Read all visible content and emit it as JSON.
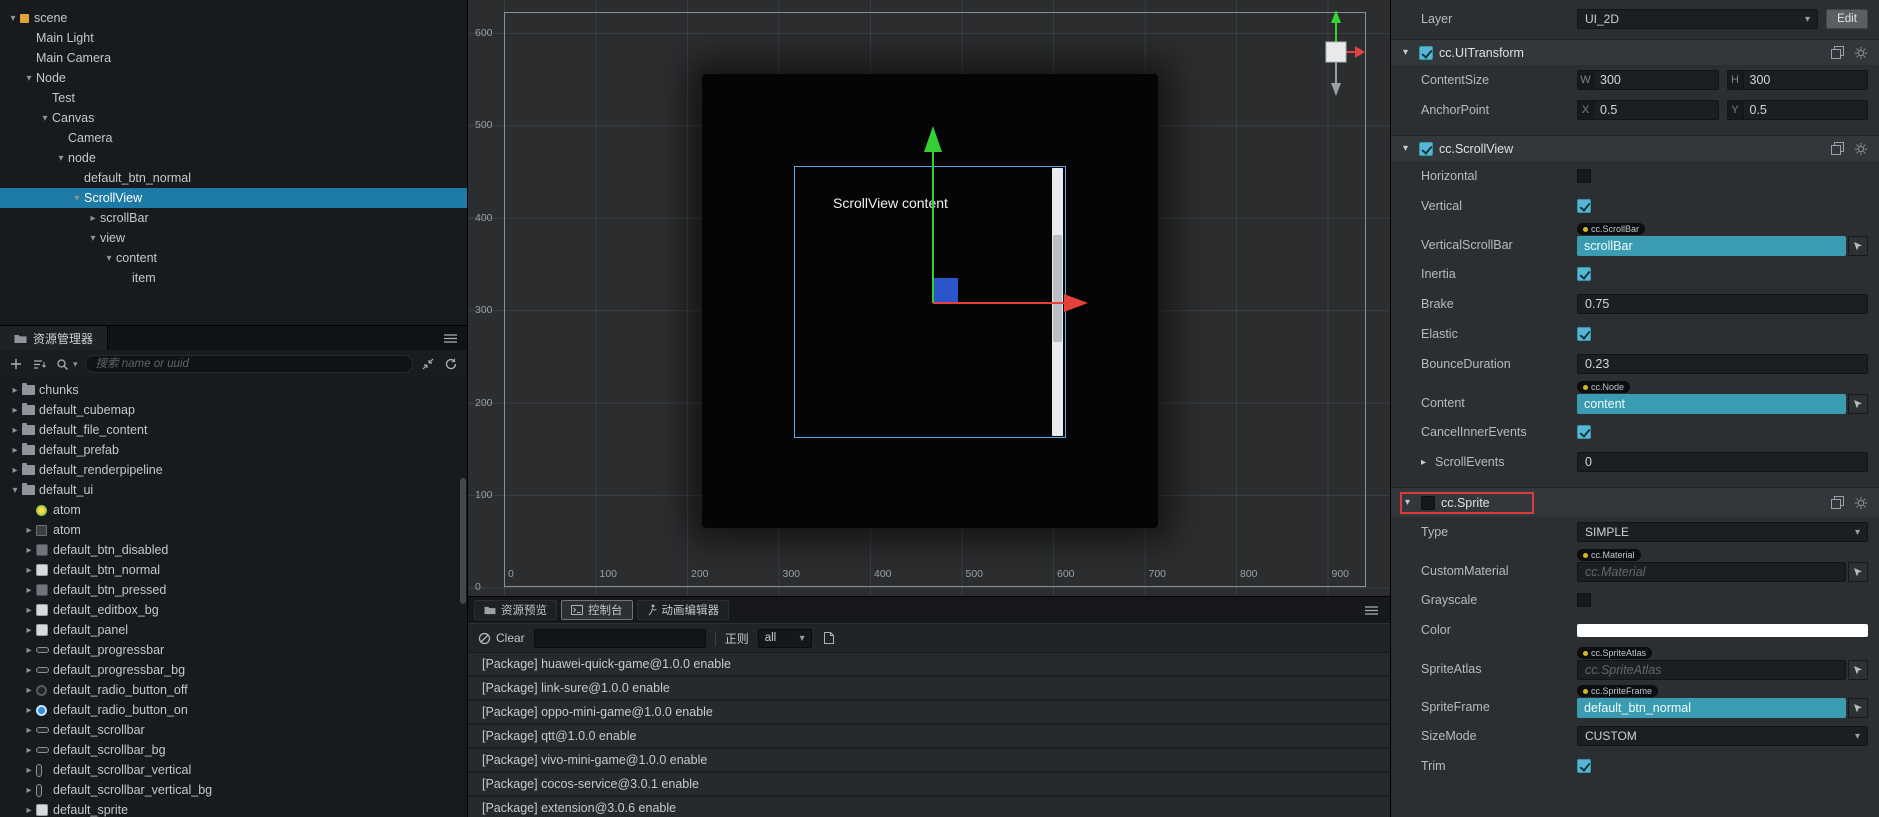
{
  "colors": {
    "selection_blue": "#1e7aa6",
    "ref_field_teal": "#3b9cb1",
    "checkbox_teal": "#55b7d4",
    "red_outline": "#dd3b3b",
    "axis_green": "#35cf35",
    "axis_red": "#e6403a",
    "anchor_blue": "#2c55cc",
    "sprite_color_value": "#FFFFFF"
  },
  "hierarchy": {
    "items": [
      {
        "label": "scene",
        "level": 0,
        "arrow": "open",
        "icon": "scene",
        "selected": false
      },
      {
        "label": "Main Light",
        "level": 1,
        "arrow": "none",
        "selected": false
      },
      {
        "label": "Main Camera",
        "level": 1,
        "arrow": "none",
        "selected": false
      },
      {
        "label": "Node",
        "level": 1,
        "arrow": "open",
        "selected": false
      },
      {
        "label": "Test",
        "level": 2,
        "arrow": "none",
        "selected": false
      },
      {
        "label": "Canvas",
        "level": 2,
        "arrow": "open",
        "selected": false
      },
      {
        "label": "Camera",
        "level": 3,
        "arrow": "none",
        "selected": false
      },
      {
        "label": "node",
        "level": 3,
        "arrow": "open",
        "selected": false
      },
      {
        "label": "default_btn_normal",
        "level": 4,
        "arrow": "none",
        "selected": false
      },
      {
        "label": "ScrollView",
        "level": 4,
        "arrow": "open",
        "selected": true
      },
      {
        "label": "scrollBar",
        "level": 5,
        "arrow": "closed",
        "selected": false
      },
      {
        "label": "view",
        "level": 5,
        "arrow": "open",
        "selected": false
      },
      {
        "label": "content",
        "level": 6,
        "arrow": "open",
        "selected": false
      },
      {
        "label": "item",
        "level": 7,
        "arrow": "none",
        "selected": false
      }
    ]
  },
  "assets": {
    "panel_title": "资源管理器",
    "search_placeholder": "搜索 name or uuid",
    "items": [
      {
        "label": "chunks",
        "level": 0,
        "arrow": "closed",
        "icon": "folder"
      },
      {
        "label": "default_cubemap",
        "level": 0,
        "arrow": "closed",
        "icon": "folder"
      },
      {
        "label": "default_file_content",
        "level": 0,
        "arrow": "closed",
        "icon": "folder"
      },
      {
        "label": "default_prefab",
        "level": 0,
        "arrow": "closed",
        "icon": "folder"
      },
      {
        "label": "default_renderpipeline",
        "level": 0,
        "arrow": "closed",
        "icon": "folder"
      },
      {
        "label": "default_ui",
        "level": 0,
        "arrow": "open",
        "icon": "folder"
      },
      {
        "label": "atom",
        "level": 1,
        "arrow": "none",
        "icon": "atom"
      },
      {
        "label": "atom",
        "level": 1,
        "arrow": "closed",
        "icon": "atom2"
      },
      {
        "label": "default_btn_disabled",
        "level": 1,
        "arrow": "closed",
        "icon": "img-gray"
      },
      {
        "label": "default_btn_normal",
        "level": 1,
        "arrow": "closed",
        "icon": "img-light"
      },
      {
        "label": "default_btn_pressed",
        "level": 1,
        "arrow": "closed",
        "icon": "img-gray"
      },
      {
        "label": "default_editbox_bg",
        "level": 1,
        "arrow": "closed",
        "icon": "img-light"
      },
      {
        "label": "default_panel",
        "level": 1,
        "arrow": "closed",
        "icon": "img-light"
      },
      {
        "label": "default_progressbar",
        "level": 1,
        "arrow": "closed",
        "icon": "bar"
      },
      {
        "label": "default_progressbar_bg",
        "level": 1,
        "arrow": "closed",
        "icon": "bar"
      },
      {
        "label": "default_radio_button_off",
        "level": 1,
        "arrow": "closed",
        "icon": "radio-off"
      },
      {
        "label": "default_radio_button_on",
        "level": 1,
        "arrow": "closed",
        "icon": "radio-on"
      },
      {
        "label": "default_scrollbar",
        "level": 1,
        "arrow": "closed",
        "icon": "bar"
      },
      {
        "label": "default_scrollbar_bg",
        "level": 1,
        "arrow": "closed",
        "icon": "bar"
      },
      {
        "label": "default_scrollbar_vertical",
        "level": 1,
        "arrow": "closed",
        "icon": "bar-v"
      },
      {
        "label": "default_scrollbar_vertical_bg",
        "level": 1,
        "arrow": "closed",
        "icon": "bar-v"
      },
      {
        "label": "default_sprite",
        "level": 1,
        "arrow": "closed",
        "icon": "img-light"
      }
    ]
  },
  "scene": {
    "ruler_left": [
      "600",
      "500",
      "400",
      "300",
      "200",
      "100",
      "0"
    ],
    "ruler_bottom": [
      "0",
      "100",
      "200",
      "300",
      "400",
      "500",
      "600",
      "700",
      "800",
      "900"
    ],
    "content_label": "ScrollView content"
  },
  "console": {
    "tabs": [
      {
        "label": "资源预览",
        "active": false
      },
      {
        "label": "控制台",
        "active": true
      },
      {
        "label": "动画编辑器",
        "active": false
      }
    ],
    "clear_label": "Clear",
    "regex_label": "正则",
    "filter_value": "all",
    "logs": [
      "[Package] huawei-quick-game@1.0.0 enable",
      "[Package] link-sure@1.0.0 enable",
      "[Package] oppo-mini-game@1.0.0 enable",
      "[Package] qtt@1.0.0 enable",
      "[Package] vivo-mini-game@1.0.0 enable",
      "[Package] cocos-service@3.0.1 enable",
      "[Package] extension@3.0.6 enable"
    ]
  },
  "inspector": {
    "layer": {
      "label": "Layer",
      "value": "UI_2D",
      "edit_label": "Edit"
    },
    "ui_transform": {
      "title": "cc.UITransform",
      "enabled": true,
      "content_size": {
        "label": "ContentSize",
        "w_label": "W",
        "w": "300",
        "h_label": "H",
        "h": "300"
      },
      "anchor_point": {
        "label": "AnchorPoint",
        "x_label": "X",
        "x": "0.5",
        "y_label": "Y",
        "y": "0.5"
      }
    },
    "scroll_view": {
      "title": "cc.ScrollView",
      "enabled": true,
      "rows": {
        "horizontal": {
          "label": "Horizontal",
          "checked": false
        },
        "vertical": {
          "label": "Vertical",
          "checked": true
        },
        "vertical_scroll_bar": {
          "label": "VerticalScrollBar",
          "chip": "cc.ScrollBar",
          "value": "scrollBar"
        },
        "inertia": {
          "label": "Inertia",
          "checked": true
        },
        "brake": {
          "label": "Brake",
          "value": "0.75"
        },
        "elastic": {
          "label": "Elastic",
          "checked": true
        },
        "bounce_duration": {
          "label": "BounceDuration",
          "value": "0.23"
        },
        "content": {
          "label": "Content",
          "chip": "cc.Node",
          "value": "content"
        },
        "cancel_inner_events": {
          "label": "CancelInnerEvents",
          "checked": true
        },
        "scroll_events": {
          "label": "ScrollEvents",
          "value": "0"
        }
      }
    },
    "sprite": {
      "title": "cc.Sprite",
      "enabled": false,
      "rows": {
        "type": {
          "label": "Type",
          "value": "SIMPLE"
        },
        "custom_material": {
          "label": "CustomMaterial",
          "chip": "cc.Material",
          "placeholder": "cc.Material"
        },
        "grayscale": {
          "label": "Grayscale",
          "checked": false
        },
        "color": {
          "label": "Color",
          "value": "#FFFFFF"
        },
        "sprite_atlas": {
          "label": "SpriteAtlas",
          "chip": "cc.SpriteAtlas",
          "placeholder": "cc.SpriteAtlas"
        },
        "sprite_frame": {
          "label": "SpriteFrame",
          "chip": "cc.SpriteFrame",
          "value": "default_btn_normal"
        },
        "size_mode": {
          "label": "SizeMode",
          "value": "CUSTOM"
        },
        "trim": {
          "label": "Trim",
          "checked": true
        }
      }
    }
  }
}
